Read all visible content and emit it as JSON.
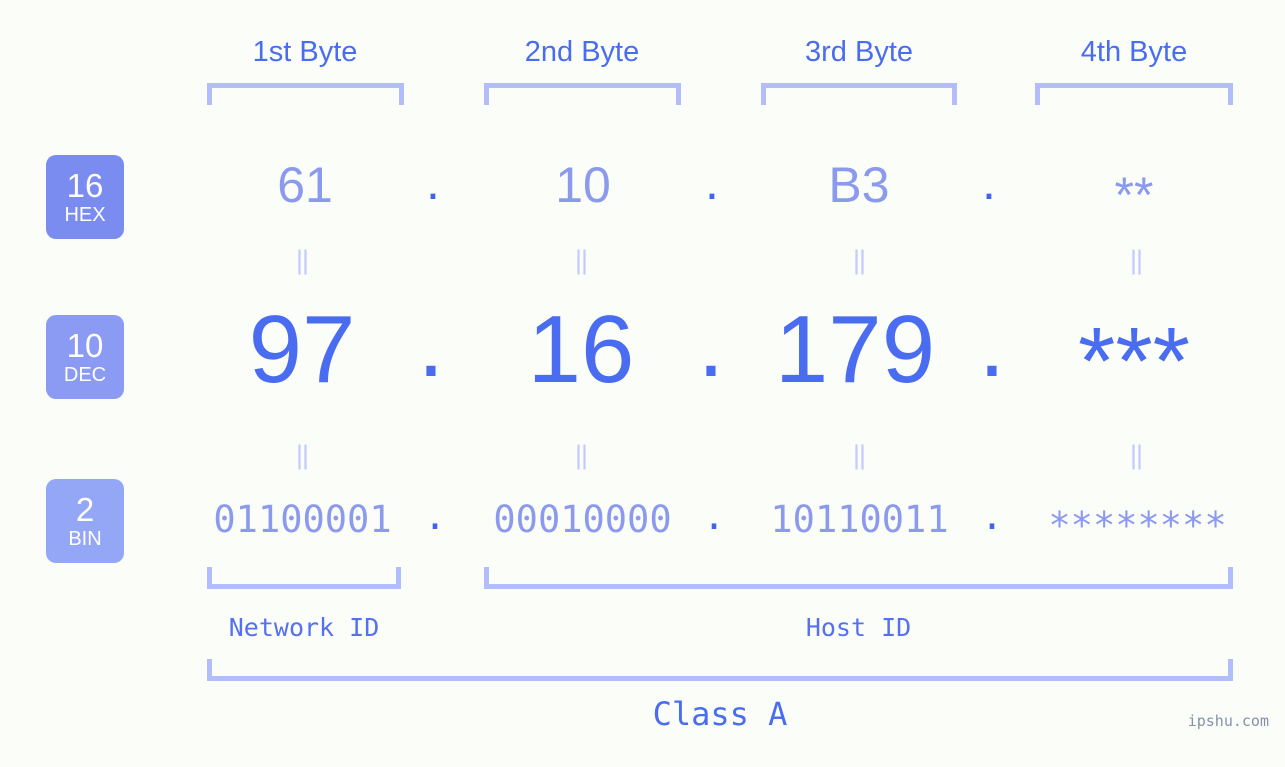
{
  "background_color": "#fbfdf9",
  "colors": {
    "bracket": "#b4bdfb",
    "byte_label": "#4a6cf0",
    "hex_value": "#8c9aed",
    "dec_value": "#4a6cf0",
    "bin_value": "#8c9aed",
    "equals_mark": "#c3cbfc",
    "badge_hex": "#7b8cf0",
    "badge_dec": "#8b9bf3",
    "badge_bin": "#94a7f7",
    "id_label": "#5571f2",
    "watermark": "#8890a8"
  },
  "byte_headers": [
    {
      "label": "1st Byte"
    },
    {
      "label": "2nd Byte"
    },
    {
      "label": "3rd Byte"
    },
    {
      "label": "4th Byte"
    }
  ],
  "bases": [
    {
      "number": "16",
      "name": "HEX"
    },
    {
      "number": "10",
      "name": "DEC"
    },
    {
      "number": "2",
      "name": "BIN"
    }
  ],
  "rows": {
    "hex": {
      "values": [
        "61",
        "10",
        "B3",
        "**"
      ],
      "separator": "."
    },
    "dec": {
      "values": [
        "97",
        "16",
        "179",
        "***"
      ],
      "separator": "."
    },
    "bin": {
      "values": [
        "01100001",
        "00010000",
        "10110011",
        "********"
      ],
      "separator": "."
    }
  },
  "equals_mark": "||",
  "id_sections": [
    {
      "label": "Network ID"
    },
    {
      "label": "Host ID"
    }
  ],
  "class_label": "Class A",
  "watermark": "ipshu.com"
}
